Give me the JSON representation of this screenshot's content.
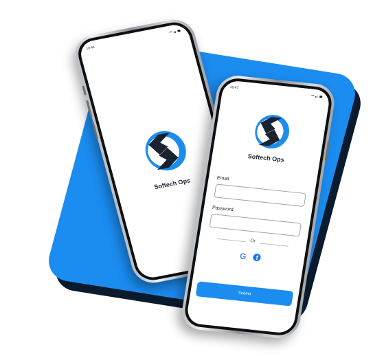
{
  "brand": {
    "name": "Softech Ops",
    "accent": "#1b8cf0",
    "dark": "#1a2330"
  },
  "splash_phone": {
    "time": "10:41",
    "status_icons": "wifi-signal-battery",
    "app_name": "Softech Ops"
  },
  "login_phone": {
    "time": "10:47",
    "status_icons": "wifi-signal-battery",
    "app_name": "Softech Ops",
    "email": {
      "label": "Email",
      "value": "",
      "placeholder": ""
    },
    "password": {
      "label": "Password",
      "value": "",
      "placeholder": ""
    },
    "divider_text": "Or",
    "social": [
      {
        "icon": "google-icon"
      },
      {
        "icon": "facebook-icon"
      }
    ],
    "submit_label": "Submit"
  }
}
